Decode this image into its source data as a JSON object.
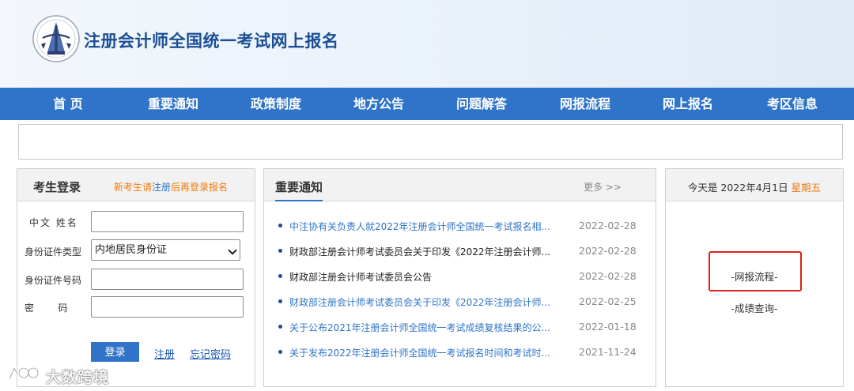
{
  "header": {
    "site_title": "注册会计师全国统一考试网上报名"
  },
  "nav": {
    "items": [
      "首 页",
      "重要通知",
      "政策制度",
      "地方公告",
      "问题解答",
      "网报流程",
      "网上报名",
      "考区信息"
    ]
  },
  "login": {
    "title": "考生登录",
    "hint_prefix": "新考生请",
    "hint_register": "注册",
    "hint_suffix": "后再登录报名",
    "name_label": "中文  姓名",
    "id_type_label": "身份证件类型",
    "id_type_value": "内地居民身份证",
    "id_number_label": "身份证件号码",
    "password_label": "密        码",
    "name_value": "",
    "id_number_value": "",
    "password_value": "",
    "login_button": "登录",
    "register_link": "注册",
    "forgot_link": "忘记密码"
  },
  "notices": {
    "title": "重要通知",
    "more": "更多 >>",
    "items": [
      {
        "text": "中注协有关负责人就2022年注册会计师全国统一考试报名相...",
        "date": "2022-02-28",
        "color": "#2f74c8"
      },
      {
        "text": "财政部注册会计师考试委员会关于印发《2022年注册会计师...",
        "date": "2022-02-28",
        "color": "#222222"
      },
      {
        "text": "财政部注册会计师考试委员会公告",
        "date": "2022-02-28",
        "color": "#222222"
      },
      {
        "text": "财政部注册会计师考试委员会关于印发《2022年注册会计师...",
        "date": "2022-02-25",
        "color": "#2f74c8"
      },
      {
        "text": "关于公布2021年注册会计师全国统一考试成绩复核结果的公...",
        "date": "2022-01-18",
        "color": "#2f74c8"
      },
      {
        "text": "关于发布2022年注册会计师全国统一考试报名时间和考试时...",
        "date": "2021-11-24",
        "color": "#2f74c8"
      }
    ]
  },
  "sidebar": {
    "date_prefix": "今天是 2022年4月1日 ",
    "weekday": "星期五",
    "links": [
      "-网报流程-",
      "-成绩查询-"
    ]
  },
  "watermark": {
    "text": "大数跨境"
  },
  "colors": {
    "nav_blue": "#2f74c8",
    "title_blue": "#1c4f95",
    "accent_orange": "#f07b10",
    "highlight_red": "#e02020"
  }
}
